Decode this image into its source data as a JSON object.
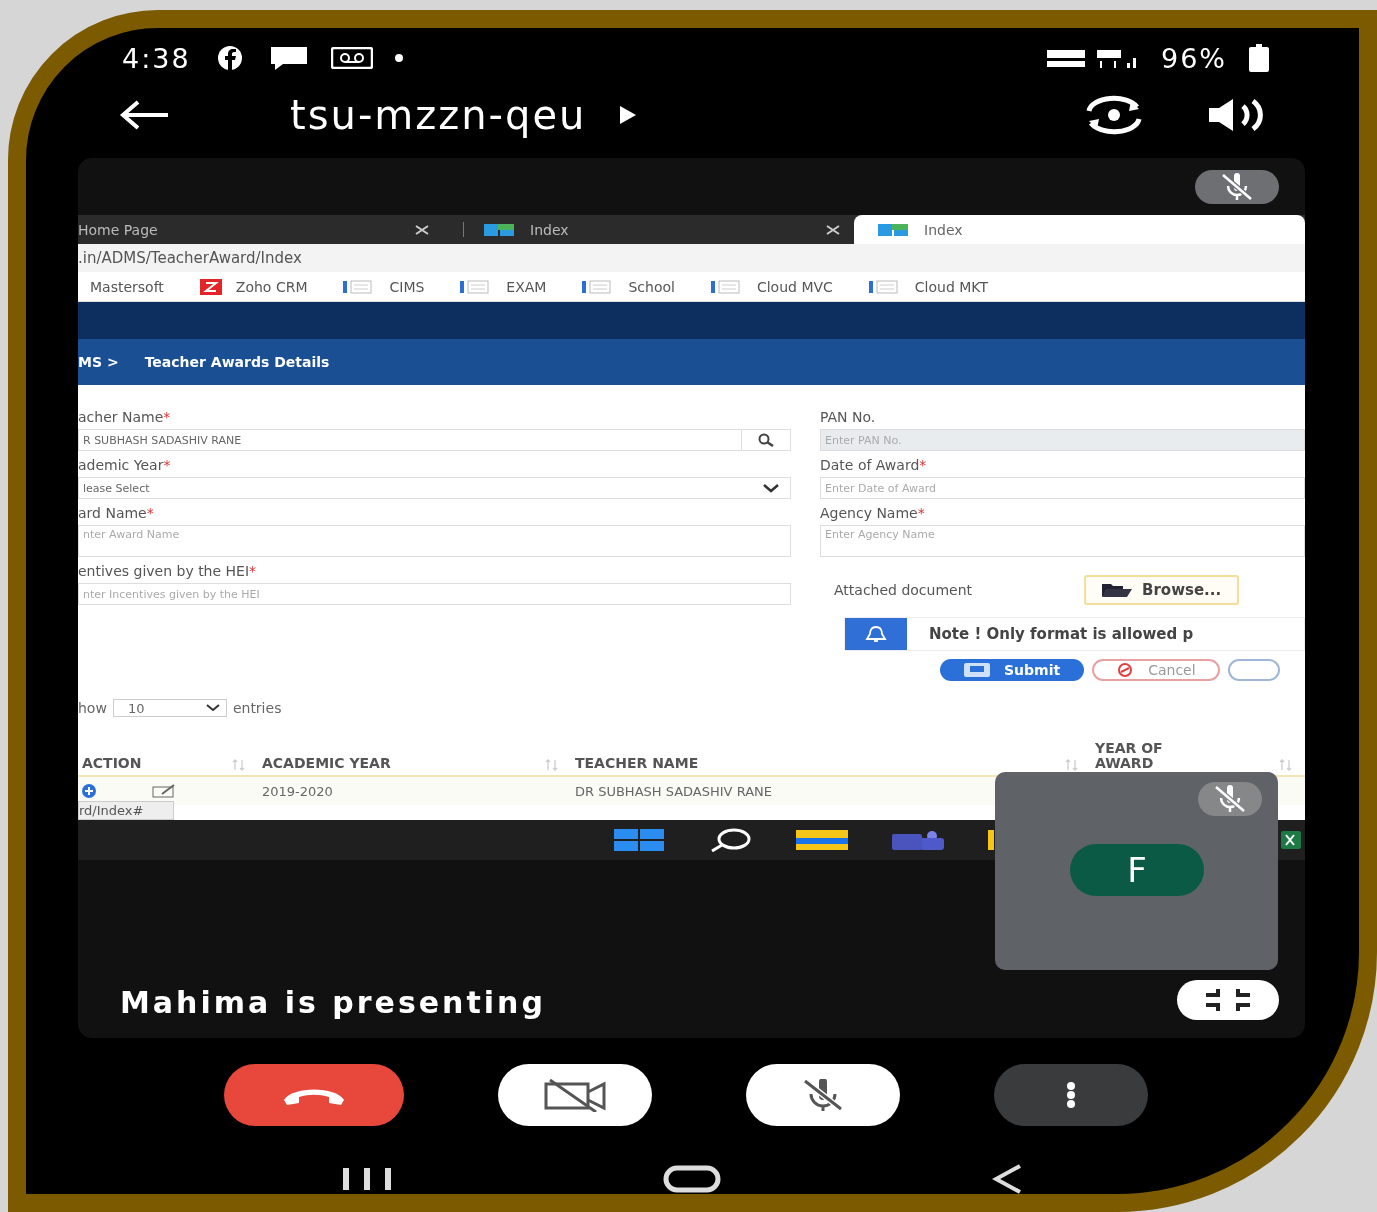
{
  "status_bar": {
    "time": "4:38",
    "battery": "96%"
  },
  "meeting": {
    "code": "tsu-mzzn-qeu",
    "presenter_label": "Mahima is presenting",
    "presenter_muted": true
  },
  "browser": {
    "tabs": [
      {
        "title": "Home Page",
        "selected": false,
        "kind": "plain"
      },
      {
        "title": "Index",
        "selected": false,
        "kind": "app"
      },
      {
        "title": "Index",
        "selected": true,
        "kind": "app"
      }
    ],
    "address": ".in/ADMS/TeacherAward/Index",
    "bookmarks": [
      {
        "label": "Mastersoft",
        "kind": "none"
      },
      {
        "label": "Zoho CRM",
        "kind": "zoho"
      },
      {
        "label": "CIMS",
        "kind": "page"
      },
      {
        "label": "EXAM",
        "kind": "page"
      },
      {
        "label": "School",
        "kind": "page"
      },
      {
        "label": "Cloud MVC",
        "kind": "page"
      },
      {
        "label": "Cloud MKT",
        "kind": "page"
      }
    ],
    "breadcrumb": {
      "parent": "MS >",
      "current": "Teacher Awards Details"
    },
    "left_fields": [
      {
        "label": "acher Name",
        "mark": "*",
        "kind": "search",
        "value": "R SUBHASH SADASHIV RANE"
      },
      {
        "label": "ademic Year",
        "mark": "*",
        "kind": "select",
        "value": "lease Select"
      },
      {
        "label": "ard Name",
        "mark": "*",
        "kind": "textarea",
        "placeholder": "nter Award Name"
      },
      {
        "label": "entives given by the HEI",
        "mark": "*",
        "kind": "text",
        "placeholder": "nter Incentives given by the HEI"
      }
    ],
    "right_fields": [
      {
        "label": "PAN No.",
        "kind": "text",
        "disabled": true,
        "placeholder": "Enter PAN No."
      },
      {
        "label": "Date of Award",
        "mark": "*",
        "kind": "text",
        "disabled": false,
        "placeholder": "Enter Date of Award"
      },
      {
        "label": "Agency Name",
        "mark": "*",
        "kind": "textarea",
        "disabled": false,
        "placeholder": "Enter Agency Name"
      }
    ],
    "attachment": {
      "label": "Attached document",
      "button": "Browse..."
    },
    "note": "Note ! Only format is allowed p",
    "actions": [
      {
        "label": "Submit",
        "kind": "primary"
      },
      {
        "label": "Cancel",
        "kind": "cancel"
      },
      {
        "kind": "cut"
      }
    ],
    "entries": {
      "prefix": "how",
      "value": "10",
      "suffix": "entries"
    },
    "table": {
      "columns": [
        {
          "label": "ACTION"
        },
        {
          "label": "ACADEMIC YEAR"
        },
        {
          "label": "TEACHER NAME"
        },
        {
          "label": "YEAR OF AWARD"
        }
      ],
      "rows": [
        {
          "academic_year": "2019-2020",
          "teacher_name": "DR SUBHASH SADASHIV RANE"
        }
      ]
    },
    "status_link": "rd/Index#"
  },
  "participant": {
    "initial": "F",
    "muted": true
  },
  "controls": [
    {
      "kind": "end"
    },
    {
      "kind": "camera",
      "on": false
    },
    {
      "kind": "mic",
      "on": false
    },
    {
      "kind": "more"
    }
  ]
}
